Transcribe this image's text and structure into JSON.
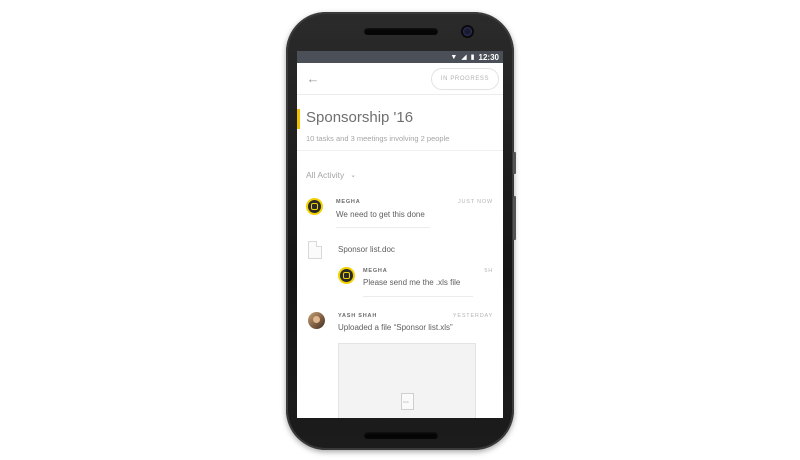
{
  "statusbar": {
    "wifi_icon": "wifi-icon",
    "signal_icon": "signal-icon",
    "battery_icon": "battery-icon",
    "time": "12:30"
  },
  "appbar": {
    "back_icon": "arrow-left-icon",
    "status": "IN PROGRESS"
  },
  "project": {
    "title": "Sponsorship '16",
    "subtitle": "10 tasks and 3 meetings involving 2 people",
    "accent_color": "#f2c200"
  },
  "filter": {
    "label": "All Activity",
    "chevron_icon": "chevron-down-icon"
  },
  "activity": [
    {
      "author": "MEGHA",
      "time": "JUST NOW",
      "text": "We need to get this done"
    },
    {
      "file_name": "Sponsor list.doc",
      "file_icon": "document-icon"
    },
    {
      "author": "MEGHA",
      "time": "5H",
      "text": "Please send me the .xls file"
    },
    {
      "author": "YASH SHAH",
      "time": "YESTERDAY",
      "text": "Uploaded a file “Sponsor list.xls”",
      "preview_label": "XLS"
    }
  ]
}
